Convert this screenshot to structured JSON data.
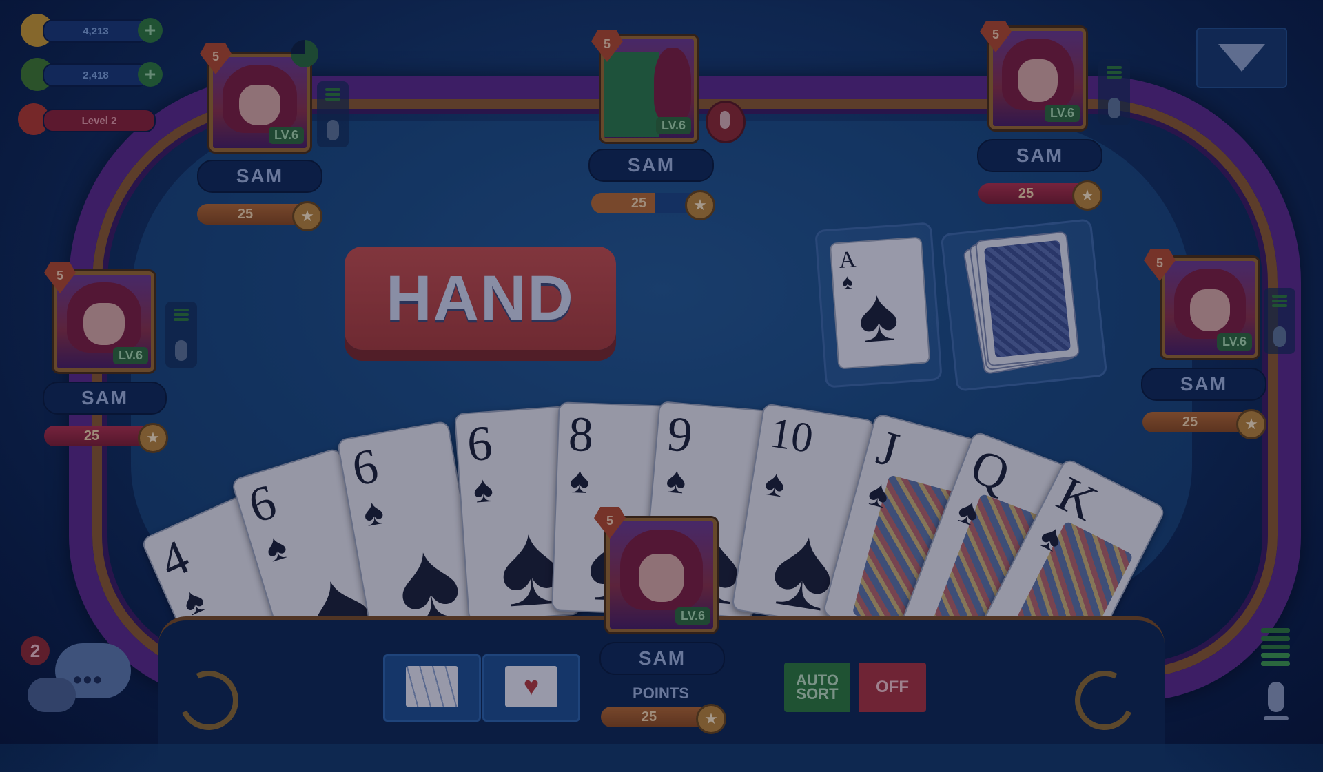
{
  "currency": {
    "coins": "4,213",
    "gems": "2,418",
    "level": "Level 2",
    "colors": {
      "coin": "#c99a2e",
      "gem": "#3f7a2c",
      "level": "#b23a2a"
    }
  },
  "dropdown": {
    "icon": "triangle-down-icon"
  },
  "players": {
    "top_left": {
      "name": "SAM",
      "level": "LV.6",
      "rank": "5",
      "score": "25"
    },
    "top_center": {
      "name": "SAM",
      "level": "LV.6",
      "rank": "5",
      "score": "25"
    },
    "top_right": {
      "name": "SAM",
      "level": "LV.6",
      "rank": "5",
      "score": "25"
    },
    "left": {
      "name": "SAM",
      "level": "LV.6",
      "rank": "5",
      "score": "25"
    },
    "right": {
      "name": "SAM",
      "level": "LV.6",
      "rank": "5",
      "score": "25"
    },
    "me": {
      "name": "SAM",
      "level": "LV.6",
      "rank": "5",
      "score": "25",
      "points_label": "POINTS"
    }
  },
  "announcement": {
    "label": "HAND"
  },
  "discard_pile": {
    "rank": "A",
    "suit": "♠"
  },
  "hand": [
    {
      "rank": "4",
      "suit": "♠"
    },
    {
      "rank": "6",
      "suit": "♠"
    },
    {
      "rank": "6",
      "suit": "♠"
    },
    {
      "rank": "6",
      "suit": "♠"
    },
    {
      "rank": "8",
      "suit": "♠"
    },
    {
      "rank": "9",
      "suit": "♠"
    },
    {
      "rank": "10",
      "suit": "♠"
    },
    {
      "rank": "J",
      "suit": "♠"
    },
    {
      "rank": "Q",
      "suit": "♠"
    },
    {
      "rank": "K",
      "suit": "♠"
    }
  ],
  "controls": {
    "auto_sort": "AUTO SORT",
    "off": "OFF"
  },
  "chat": {
    "badge": "2"
  }
}
